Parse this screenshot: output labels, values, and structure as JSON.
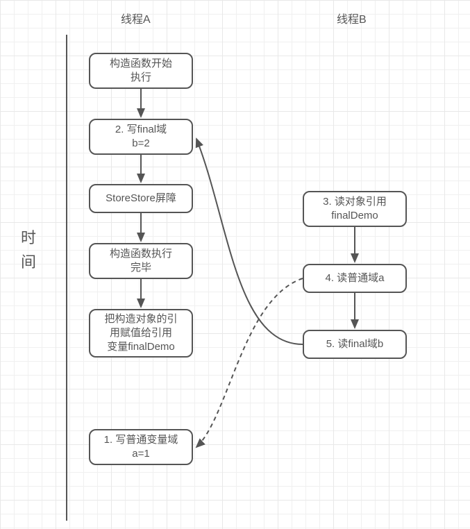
{
  "headers": {
    "threadA": "线程A",
    "threadB": "线程B",
    "time": "时\n间"
  },
  "boxes": {
    "a1": "构造函数开始\n执行",
    "a2": "2. 写final域\nb=2",
    "a3": "StoreStore屏障",
    "a4": "构造函数执行\n完毕",
    "a5": "把构造对象的引\n用赋值给引用\n变量finalDemo",
    "a6": "1. 写普通变量域\na=1",
    "b1": "3. 读对象引用\nfinalDemo",
    "b2": "4. 读普通域a",
    "b3": "5. 读final域b"
  }
}
